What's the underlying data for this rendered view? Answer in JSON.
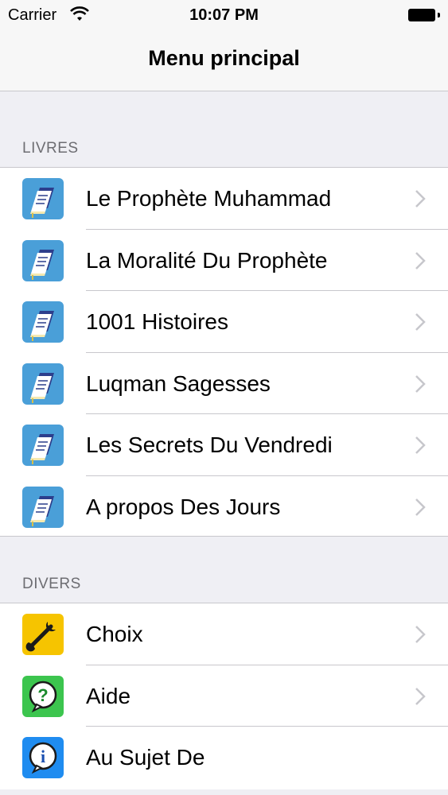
{
  "status_bar": {
    "carrier": "Carrier",
    "time": "10:07 PM",
    "icons": [
      "wifi-icon",
      "battery-icon"
    ]
  },
  "nav": {
    "title": "Menu principal"
  },
  "sections": {
    "livres": {
      "header": "LIVRES",
      "items": [
        {
          "label": "Le Prophète Muhammad",
          "icon": "book-icon"
        },
        {
          "label": "La Moralité Du Prophète",
          "icon": "book-icon"
        },
        {
          "label": "1001 Histoires",
          "icon": "book-icon"
        },
        {
          "label": "Luqman Sagesses",
          "icon": "book-icon"
        },
        {
          "label": "Les Secrets Du Vendredi",
          "icon": "book-icon"
        },
        {
          "label": "A propos Des Jours",
          "icon": "book-icon"
        }
      ]
    },
    "divers": {
      "header": "DIVERS",
      "items": [
        {
          "label": "Choix",
          "icon": "wrench-icon"
        },
        {
          "label": "Aide",
          "icon": "help-icon"
        },
        {
          "label": "Au Sujet De",
          "icon": "info-icon"
        }
      ]
    }
  },
  "colors": {
    "background": "#efeff4",
    "book_icon": "#4a9fd8",
    "wrench_icon": "#f6c400",
    "help_icon": "#3cc54e",
    "info_icon": "#1f8cf0",
    "chevron": "#c7c7cc"
  }
}
